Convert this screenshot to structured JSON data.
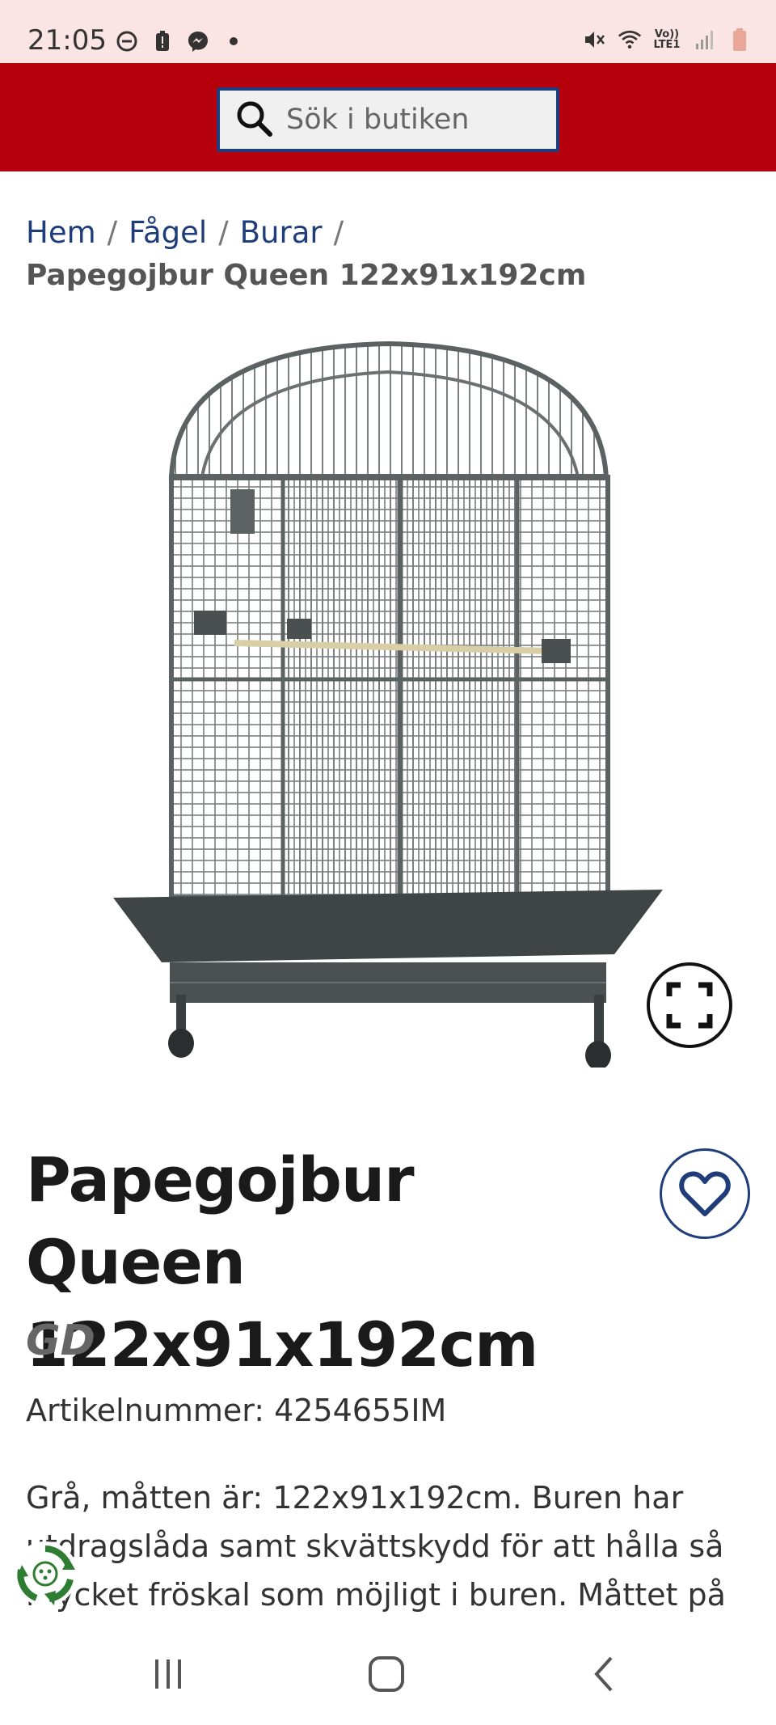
{
  "status_bar": {
    "time": "21:05",
    "network_label": "Vo)) LTE1"
  },
  "search": {
    "placeholder": "Sök i butiken"
  },
  "breadcrumb": {
    "items": [
      "Hem",
      "Fågel",
      "Burar"
    ],
    "separator": "/",
    "current": "Papegojbur Queen 122x91x192cm"
  },
  "product": {
    "title": "Papegojbur Queen 122x91x192cm",
    "brand": "GD",
    "sku_label": "Artikelnummer: 4254655IM",
    "description": "Grå, måtten är: 122x91x192cm. Buren har utdragslåda samt skvättskydd för att hålla så mycket fröskal som möjligt i buren. Måttet på"
  },
  "colors": {
    "header_bg": "#b7000d",
    "status_bg": "#fbe4e4",
    "link": "#1f3d7a"
  },
  "icons": {
    "search": "search-icon",
    "fullscreen": "fullscreen-icon",
    "favorite": "heart-icon",
    "eco": "recycle-icon"
  }
}
